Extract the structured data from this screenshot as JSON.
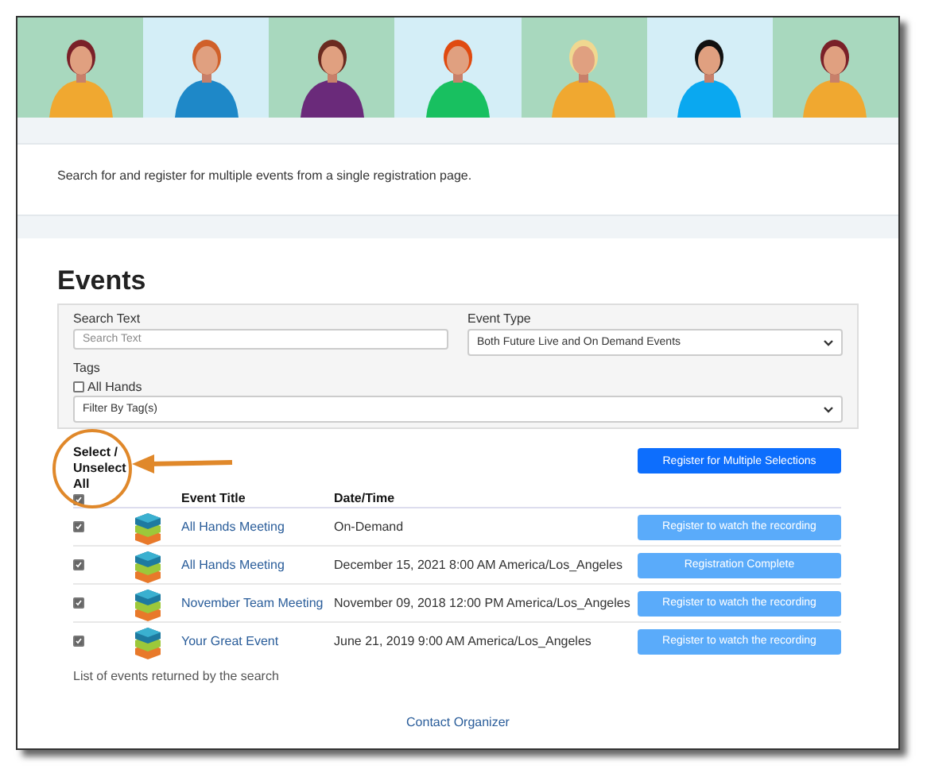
{
  "description": "Search for and register for multiple events from a single registration page.",
  "events_heading": "Events",
  "filters": {
    "search": {
      "label": "Search Text",
      "placeholder": "Search Text"
    },
    "event_type": {
      "label": "Event Type",
      "value": "Both Future Live and On Demand Events"
    },
    "tags": {
      "label": "Tags",
      "options": [
        {
          "label": "All Hands",
          "checked": false
        }
      ],
      "select_value": "Filter By Tag(s)"
    }
  },
  "table": {
    "select_all": {
      "label": "Select / Unselect All",
      "checked": true
    },
    "register_multiple": "Register for Multiple Selections",
    "columns": [
      "Event Title",
      "Date/Time"
    ],
    "rows": [
      {
        "checked": true,
        "title": "All Hands Meeting",
        "datetime": "On-Demand",
        "action": "Register to watch the recording"
      },
      {
        "checked": true,
        "title": "All Hands Meeting",
        "datetime": "December 15, 2021 8:00 AM America/Los_Angeles",
        "action": "Registration Complete"
      },
      {
        "checked": true,
        "title": "November Team Meeting",
        "datetime": "November 09, 2018 12:00 PM America/Los_Angeles",
        "action": "Register to watch the recording"
      },
      {
        "checked": true,
        "title": "Your Great Event",
        "datetime": "June 21, 2019 9:00 AM America/Los_Angeles",
        "action": "Register to watch the recording"
      }
    ],
    "caption": "List of events returned by the search"
  },
  "footer_link": "Contact Organizer"
}
